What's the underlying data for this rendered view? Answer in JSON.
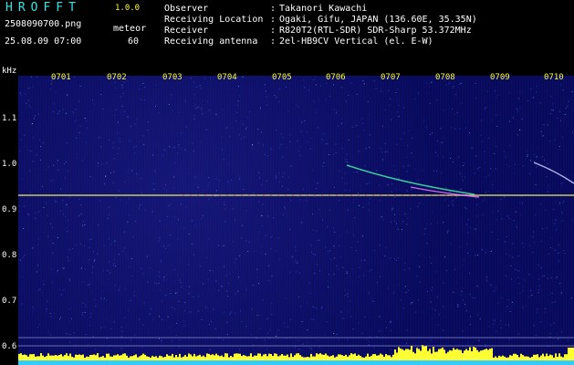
{
  "header": {
    "app_title": "HROFFT",
    "app_version": "1.0.0",
    "filename": "2508090700.png",
    "timestamp": "25.08.09 07:00",
    "meteor_label": "meteor",
    "meteor_count": "60"
  },
  "info": [
    {
      "label": "Observer",
      "value": "Takanori Kawachi"
    },
    {
      "label": "Receiving Location",
      "value": "Ogaki, Gifu, JAPAN (136.60E, 35.35N)"
    },
    {
      "label": "Receiver",
      "value": "R820T2(RTL-SDR) SDR-Sharp 53.372MHz"
    },
    {
      "label": "Receiving antenna",
      "value": "2el-HB9CV Vertical (el. E-W)"
    }
  ],
  "plot": {
    "unit_label": "kHz",
    "separator": ":",
    "x_ticks": [
      "0701",
      "0702",
      "0703",
      "0704",
      "0705",
      "0706",
      "0707",
      "0708",
      "0709",
      "0710"
    ],
    "y_ticks": [
      "1.1",
      "1.0",
      "0.9",
      "0.8",
      "0.7",
      "0.6"
    ],
    "colors": {
      "background": "#09095e",
      "carrier": "#d8e060",
      "level_bar": "#ffff33",
      "level_base": "#33ccff"
    }
  }
}
